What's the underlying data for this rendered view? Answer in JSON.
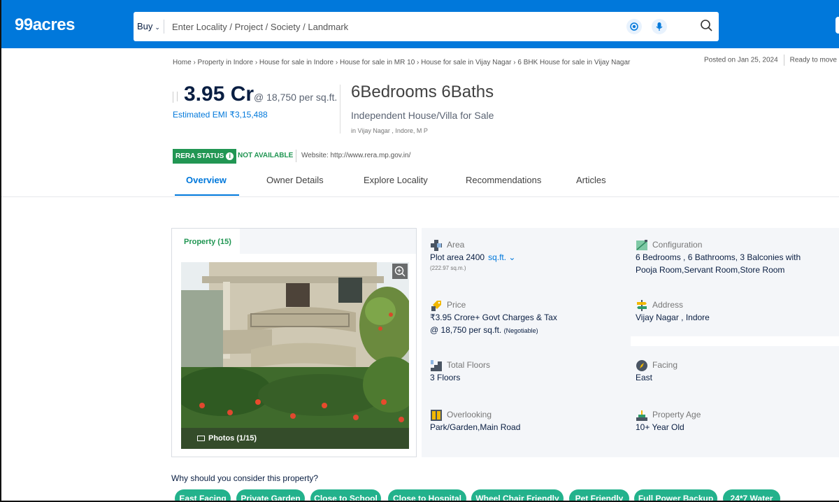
{
  "header": {
    "logo": "99acres",
    "search_mode": "Buy",
    "search_placeholder": "Enter Locality / Project / Society / Landmark",
    "accent": "#0078db"
  },
  "breadcrumb": "Home › Property in Indore › House for sale in Indore › House for sale in MR 10 › House for sale in Vijay Nagar › 6 BHK House for sale in Vijay Nagar",
  "posted": "Posted on Jan 25, 2024",
  "status": "Ready to move",
  "listing": {
    "price": "3.95 Cr",
    "price_per_sqft": "@ 18,750 per sq.ft.",
    "emi": "Estimated EMI ₹3,15,488",
    "title": "6Bedrooms 6Baths",
    "subtitle": "Independent House/Villa for Sale",
    "location": "in Vijay Nagar , Indore, M P"
  },
  "rera": {
    "badge": "RERA STATUS",
    "status": "NOT AVAILABLE",
    "website": "Website: http://www.rera.mp.gov.in/"
  },
  "tabs": [
    "Overview",
    "Owner Details",
    "Explore Locality",
    "Recommendations",
    "Articles"
  ],
  "photos": {
    "tab": "Property (15)",
    "counter": "Photos (1/15)"
  },
  "details": {
    "area": {
      "label": "Area",
      "value": "Plot area 2400",
      "unit": "sq.ft.",
      "note": "(222.97 sq.m.)"
    },
    "configuration": {
      "label": "Configuration",
      "value": "6 Bedrooms , 6 Bathrooms, 3 Balconies with Pooja Room,Servant Room,Store Room"
    },
    "price": {
      "label": "Price",
      "value": "₹3.95 Crore+ Govt Charges & Tax",
      "value2": "@ 18,750 per sq.ft.",
      "negotiable": "(Negotiable)"
    },
    "address": {
      "label": "Address",
      "value": "Vijay Nagar , Indore"
    },
    "floors": {
      "label": "Total Floors",
      "value": "3 Floors"
    },
    "facing": {
      "label": "Facing",
      "value": "East"
    },
    "overlooking": {
      "label": "Overlooking",
      "value": "Park/Garden,Main Road"
    },
    "age": {
      "label": "Property Age",
      "value": "10+ Year Old"
    }
  },
  "why_heading": "Why should you consider this property?",
  "chips": [
    "East Facing",
    "Private Garden",
    "Close to School",
    "Close to Hospital",
    "Wheel Chair Friendly",
    "Pet Friendly",
    "Full Power Backup",
    "24*7 Water"
  ]
}
